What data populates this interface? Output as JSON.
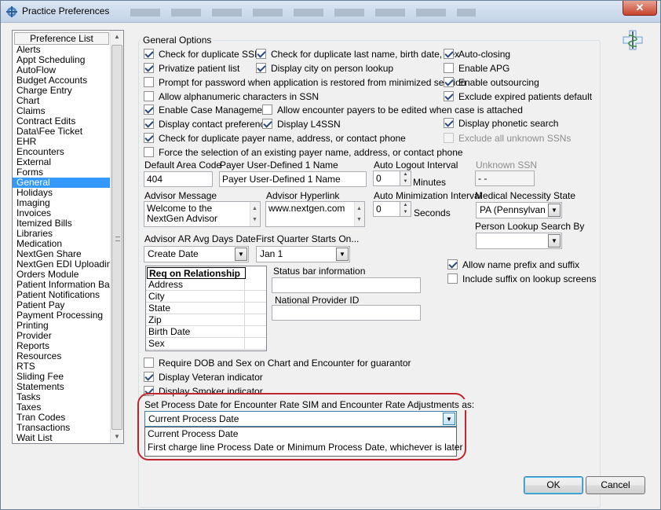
{
  "window": {
    "title": "Practice Preferences",
    "close_glyph": "✕"
  },
  "preference_list": {
    "header": "Preference List",
    "selected": "General",
    "items": [
      "Alerts",
      "Appt Scheduling",
      "AutoFlow",
      "Budget Accounts",
      "Charge Entry",
      "Chart",
      "Claims",
      "Contract Edits",
      "Data\\Fee Ticket",
      "EHR",
      "Encounters",
      "External",
      "Forms",
      "General",
      "Holidays",
      "Imaging",
      "Invoices",
      "Itemized Bills",
      "Libraries",
      "Medication",
      "NextGen Share",
      "NextGen EDI Uploading",
      "Orders Module",
      "Patient Information Bar",
      "Patient Notifications",
      "Patient Pay",
      "Payment Processing",
      "Printing",
      "Provider",
      "Reports",
      "Resources",
      "RTS",
      "Sliding Fee",
      "Statements",
      "Tasks",
      "Taxes",
      "Tran Codes",
      "Transactions",
      "Wait List"
    ]
  },
  "general": {
    "group_title": "General Options",
    "checkboxes": {
      "dup_ssn": {
        "label": "Check for duplicate SSN",
        "checked": true
      },
      "dup_last_name": {
        "label": "Check for duplicate last name, birth date, sex",
        "checked": true
      },
      "auto_closing": {
        "label": "Auto-closing",
        "checked": true
      },
      "privatize": {
        "label": "Privatize patient list",
        "checked": true
      },
      "display_city": {
        "label": "Display city on person lookup",
        "checked": true
      },
      "enable_apg": {
        "label": "Enable APG",
        "checked": false
      },
      "prompt_password": {
        "label": "Prompt for password when application is restored from minimized session",
        "checked": false
      },
      "enable_outsourcing": {
        "label": "Enable outsourcing",
        "checked": true
      },
      "alphanumeric_ssn": {
        "label": "Allow alphanumeric characters in SSN",
        "checked": false
      },
      "exclude_expired": {
        "label": "Exclude expired patients default",
        "checked": true
      },
      "case_mgmt": {
        "label": "Enable Case Management",
        "checked": true
      },
      "encounter_payers": {
        "label": "Allow encounter payers to be edited when case is attached",
        "checked": false
      },
      "contact_pref": {
        "label": "Display contact preference",
        "checked": true
      },
      "l4ssn": {
        "label": "Display L4SSN",
        "checked": true
      },
      "phonetic": {
        "label": "Display phonetic search",
        "checked": true
      },
      "dup_payer": {
        "label": "Check for duplicate payer name, address, or contact phone",
        "checked": true
      },
      "exclude_unknown_ssn": {
        "label": "Exclude all unknown SSNs",
        "checked": false
      },
      "force_payer": {
        "label": "Force the selection of an existing payer name, address, or contact phone",
        "checked": false
      },
      "name_prefix": {
        "label": "Allow name prefix and suffix",
        "checked": true
      },
      "include_suffix": {
        "label": "Include suffix on lookup screens",
        "checked": false
      },
      "require_dob": {
        "label": "Require DOB and Sex on Chart and Encounter for guarantor",
        "checked": false
      },
      "veteran": {
        "label": "Display Veteran indicator",
        "checked": true
      },
      "smoker": {
        "label": "Display Smoker indicator",
        "checked": true
      }
    },
    "fields": {
      "default_area_code": {
        "label": "Default Area Code",
        "value": "404"
      },
      "payer_udf1": {
        "label": "Payer User-Defined 1 Name",
        "value": "Payer User-Defined 1 Name"
      },
      "auto_logout": {
        "label": "Auto Logout Interval",
        "value": "0",
        "unit": "Minutes"
      },
      "unknown_ssn": {
        "label": "Unknown SSN",
        "value": "-  -"
      },
      "advisor_message": {
        "label": "Advisor Message",
        "value": "Welcome to the NextGen Advisor"
      },
      "advisor_hyperlink": {
        "label": "Advisor Hyperlink",
        "value": "www.nextgen.com"
      },
      "auto_minimization": {
        "label": "Auto Minimization Interval",
        "value": "0",
        "unit": "Seconds"
      },
      "medical_necessity_state": {
        "label": "Medical Necessity State",
        "value": "PA   (Pennsylvan"
      },
      "person_lookup_search_by": {
        "label": "Person Lookup Search By",
        "value": ""
      },
      "advisor_ar_avg": {
        "label": "Advisor AR Avg Days Date",
        "value": "Create Date"
      },
      "first_quarter": {
        "label": "First Quarter Starts On...",
        "value": "Jan 1"
      },
      "status_bar_info": {
        "label": "Status bar information",
        "value": ""
      },
      "national_provider_id": {
        "label": "National Provider ID",
        "value": ""
      }
    },
    "req_grid": {
      "header": "Req on Relationship",
      "rows": [
        "Address",
        "City",
        "State",
        "Zip",
        "Birth Date",
        "Sex"
      ]
    },
    "process_date": {
      "label": "Set Process Date for Encounter Rate SIM and Encounter Rate Adjustments as:",
      "selected": "Current Process Date",
      "options": [
        "Current Process Date",
        "First charge line Process Date or Minimum Process Date, whichever is later"
      ]
    }
  },
  "buttons": {
    "ok": "OK",
    "cancel": "Cancel"
  }
}
